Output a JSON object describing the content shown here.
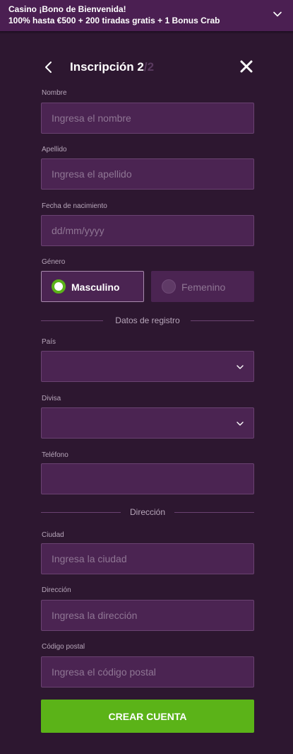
{
  "banner": {
    "line1": "Casino ¡Bono de Bienvenida!",
    "line2": "100% hasta €500 + 200 tiradas gratis + 1 Bonus Crab",
    "icon": "chevron-down-icon"
  },
  "header": {
    "title": "Inscripción",
    "step": "2",
    "total": "/2",
    "back_icon": "chevron-left-icon",
    "close_icon": "close-icon"
  },
  "fields": {
    "nombre": {
      "label": "Nombre",
      "placeholder": "Ingresa el nombre",
      "value": ""
    },
    "apellido": {
      "label": "Apellido",
      "placeholder": "Ingresa el apellido",
      "value": ""
    },
    "fecha": {
      "label": "Fecha de nacimiento",
      "placeholder": "dd/mm/yyyy",
      "value": ""
    },
    "genero": {
      "label": "Género",
      "options": [
        {
          "label": "Masculino",
          "selected": true
        },
        {
          "label": "Femenino",
          "selected": false
        }
      ]
    },
    "pais": {
      "label": "País",
      "value": ""
    },
    "divisa": {
      "label": "Divisa",
      "value": ""
    },
    "telefono": {
      "label": "Teléfono",
      "value": ""
    },
    "ciudad": {
      "label": "Ciudad",
      "placeholder": "Ingresa la ciudad",
      "value": ""
    },
    "direccion": {
      "label": "Dirección",
      "placeholder": "Ingresa la dirección",
      "value": ""
    },
    "codigo_postal": {
      "label": "Código postal",
      "placeholder": "Ingresa el código postal",
      "value": ""
    }
  },
  "sections": {
    "registro": "Datos de registro",
    "direccion": "Dirección"
  },
  "submit": {
    "label": "CREAR CUENTA"
  },
  "colors": {
    "background": "#2d1730",
    "banner": "#4b1f52",
    "input": "#4b2452",
    "accent": "#5bb318"
  }
}
